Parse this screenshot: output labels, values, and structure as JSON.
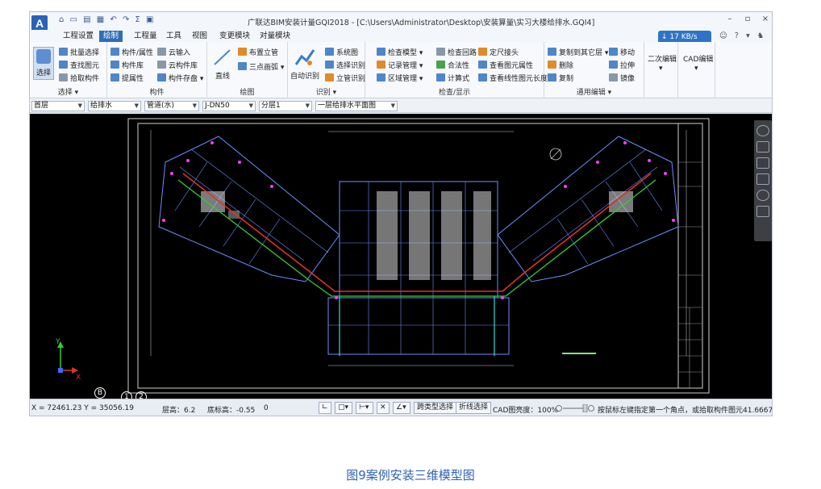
{
  "app": {
    "logo_letter": "A",
    "quick_access": "⌂ ▭ ▤ ▦ ↶ ↷ Σ ▣",
    "title": "广联达BIM安装计量GQI2018 - [C:\\Users\\Administrator\\Desktop\\安装算量\\实习大楼给排水.GQI4]"
  },
  "window_controls": {
    "minimize": "–",
    "restore": "▫",
    "close": "×"
  },
  "menu": {
    "tabs": [
      "工程设置",
      "绘制",
      "工程量",
      "工具",
      "视图",
      "变更模块",
      "对量模块"
    ],
    "active_index": 1
  },
  "net_badge": {
    "text": "↓ 17 KB/s"
  },
  "help_icons": "☺ ? ▾ ♞ ▣",
  "ribbon": {
    "select_group": {
      "big": "选择",
      "items": [
        "批量选择",
        "查找图元",
        "拾取构件"
      ],
      "caption": "选择 ▾"
    },
    "component_group": {
      "col1": [
        "构件/属性",
        "构件库",
        "提属性"
      ],
      "col2": [
        "云输入",
        "云构件库",
        "构件存盘 ▾"
      ],
      "caption": "构件"
    },
    "draw_group": {
      "big": "直线",
      "items": [
        "布置立管",
        "三点画弧 ▾"
      ],
      "caption": "绘图"
    },
    "identify_group": {
      "big": "自动识别",
      "items": [
        "系统图",
        "选择识别",
        "立管识别"
      ],
      "caption": "识别 ▾"
    },
    "check_group": {
      "col1": [
        "检查模型 ▾",
        "记录管理 ▾",
        "区域管理 ▾"
      ],
      "col2": [
        "检查回路",
        "合法性",
        "计算式"
      ],
      "col3": [
        "定尺接头",
        "查看图元属性",
        "查看线性图元长度"
      ],
      "caption": "检查/显示"
    },
    "edit_group": {
      "col1": [
        "复制到其它层 ▾",
        "删除",
        "复制"
      ],
      "col2": [
        "移动",
        "拉伸",
        "镜像"
      ],
      "caption": "通用编辑 ▾"
    },
    "secondary_edit": {
      "label": "二次编辑",
      "arrow": "▾"
    },
    "cad_edit": {
      "label": "CAD编辑",
      "arrow": "▾"
    }
  },
  "property_bar": {
    "floor": "首层",
    "discipline": "给排水",
    "type": "管道(水)",
    "component": "J-DN50",
    "layer": "分层1",
    "drawing": "一层给排水平面图"
  },
  "canvas": {
    "axis_x": "X",
    "axis_y": "Y",
    "grid_b": "B",
    "grid_1": "1",
    "grid_2": "2"
  },
  "status": {
    "coords": "X = 72461.23 Y = 35056.19",
    "floor_height": "层高：6.2",
    "base_height": "底标高：-0.55",
    "zero": "0",
    "cross_type_select": "跨类型选择",
    "polyline_select": "折线选择",
    "cad_brightness": "CAD图亮度：100%",
    "hint": "按鼠标左键指定第一个角点，或拾取构件图元41.6667 FPS"
  },
  "caption": "图9案例安装三维模型图",
  "colors": {
    "accent": "#2f6db8",
    "pipe_red": "#e03030",
    "pipe_green": "#2ecc40",
    "cad_blue": "#6f8cff",
    "cad_magenta": "#ff3cff"
  }
}
